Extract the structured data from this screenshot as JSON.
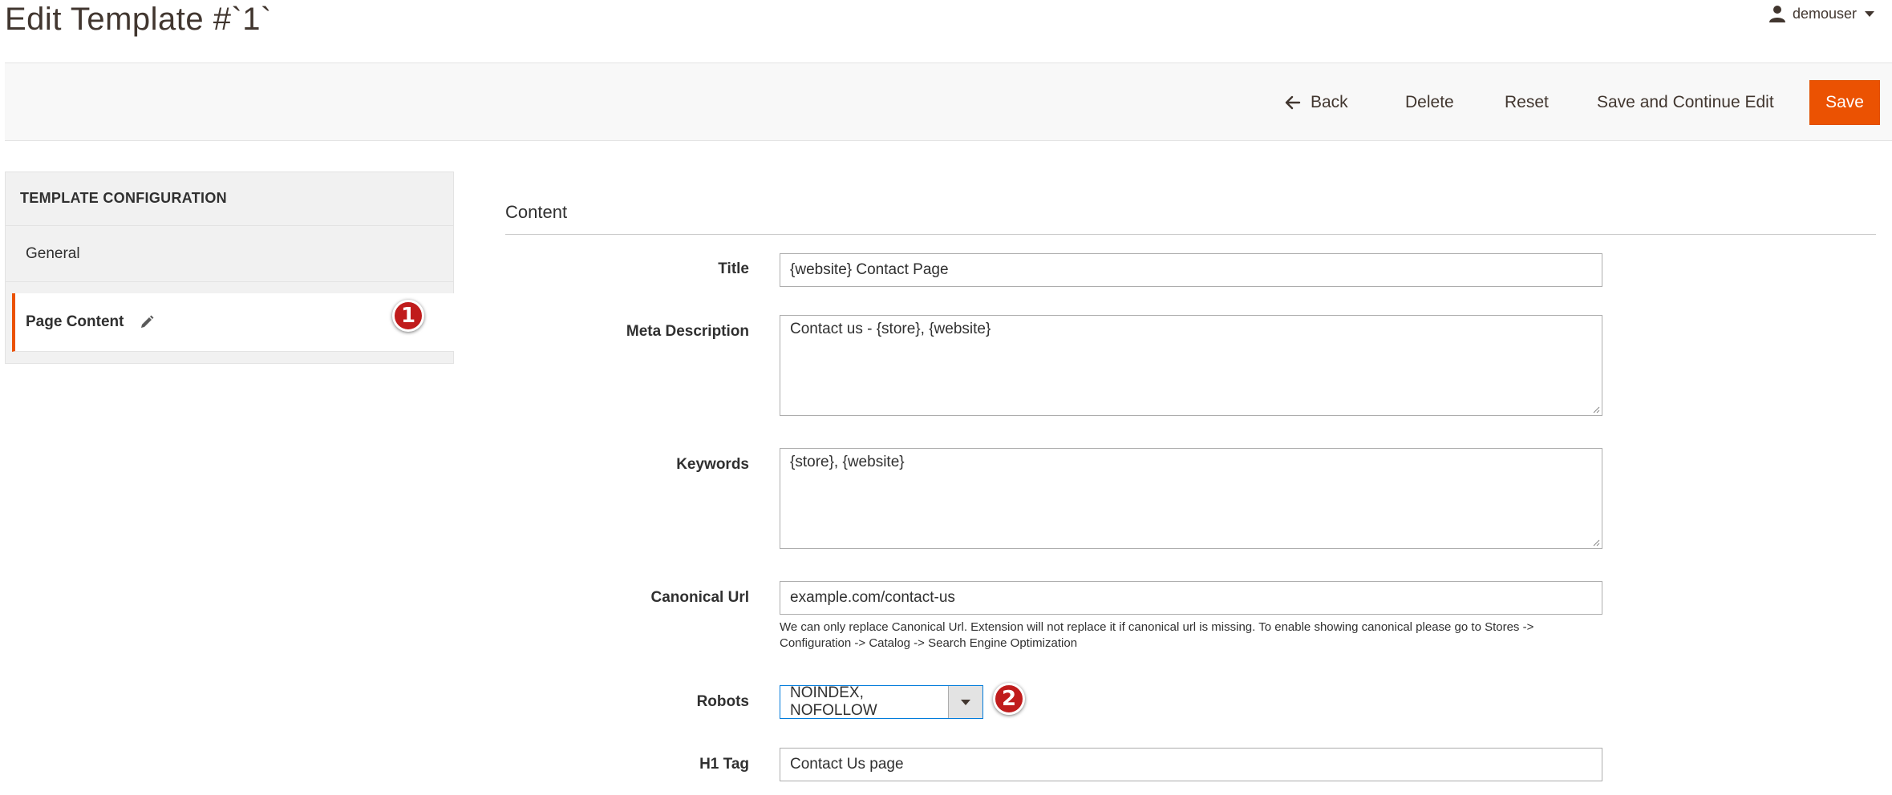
{
  "header": {
    "title": "Edit Template #`1`",
    "user_name": "demouser"
  },
  "actions": {
    "back": "Back",
    "delete": "Delete",
    "reset": "Reset",
    "save_continue": "Save and Continue Edit",
    "save": "Save"
  },
  "sidebar": {
    "title": "TEMPLATE CONFIGURATION",
    "items": [
      {
        "label": "General"
      },
      {
        "label": "Page Content"
      }
    ]
  },
  "markers": [
    "1",
    "2"
  ],
  "content": {
    "section_title": "Content",
    "title_label": "Title",
    "title_value": "{website} Contact Page",
    "meta_label": "Meta Description",
    "meta_value": "Contact us - {store}, {website}",
    "keywords_label": "Keywords",
    "keywords_value": "{store}, {website}",
    "canonical_label": "Canonical Url",
    "canonical_value": "example.com/contact-us",
    "canonical_note": "We can only replace Canonical Url. Extension will not replace it if canonical url is missing. To enable showing canonical please go to Stores -> Configuration -> Catalog -> Search Engine Optimization",
    "robots_label": "Robots",
    "robots_value": "NOINDEX, NOFOLLOW",
    "h1_label": "H1 Tag",
    "h1_value": "Contact Us page"
  },
  "colors": {
    "accent": "#eb5202",
    "marker": "#c01c1c",
    "focus_border": "#007bdb"
  }
}
